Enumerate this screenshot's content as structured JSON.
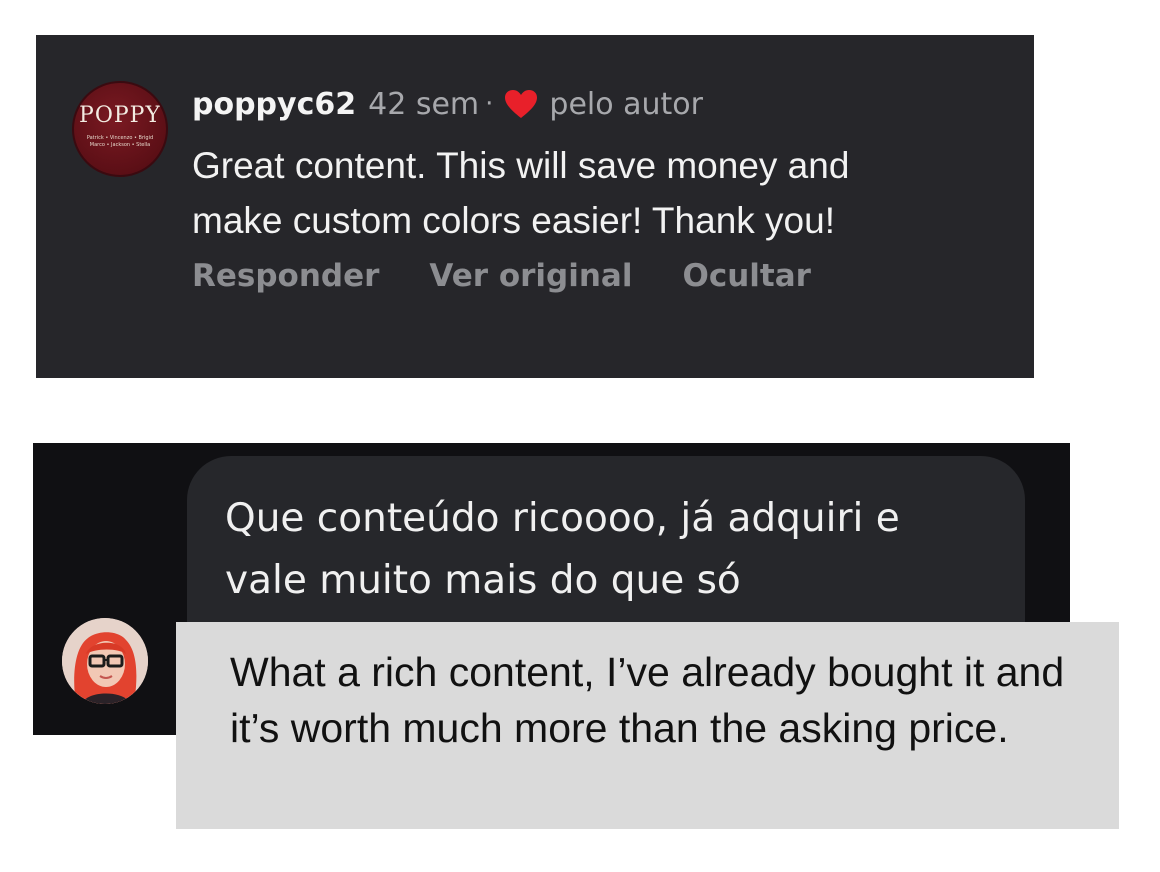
{
  "comment": {
    "avatar": {
      "logo_text": "POPPY",
      "logo_subtext": "Patrick • Vincenzo • Brigid Marco • Jackson • Stella"
    },
    "username": "poppyc62",
    "time_ago": "42 sem",
    "separator": "·",
    "liked_icon": "heart-icon",
    "liked_by_label": "pelo autor",
    "text": "Great content. This will save money and make custom colors easier! Thank you!",
    "actions": {
      "reply": "Responder",
      "see_original": "Ver original",
      "hide": "Ocultar"
    }
  },
  "message": {
    "avatar_icon": "user-avatar",
    "text": "Que conteúdo ricoooo, já adquiri e vale muito mais do que só"
  },
  "translation": {
    "text": "What a rich content, I’ve already bought it and it’s worth much more than the asking price."
  },
  "colors": {
    "card_bg": "#26262a",
    "dm_bg": "#101013",
    "bubble_bg": "#26272b",
    "heart": "#e8202a",
    "translation_bg": "#dadada"
  }
}
